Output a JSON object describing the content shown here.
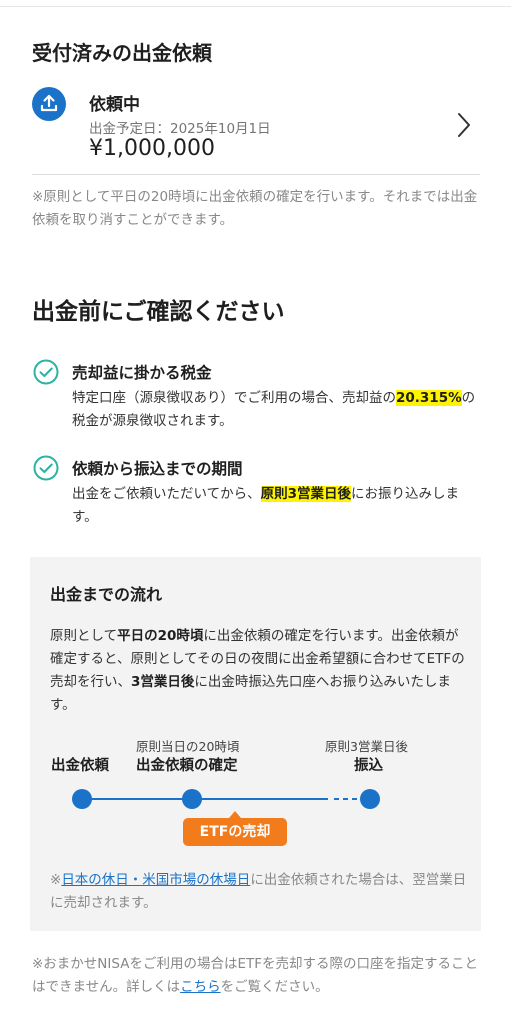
{
  "request_section": {
    "title": "受付済みの出金依頼",
    "status": "依頼中",
    "date_label": "出金予定日：",
    "date_value": "2025年10月1日",
    "amount": "¥1,000,000",
    "note": "※原則として平日の20時頃に出金依頼の確定を行います。それまでは出金依頼を取り消すことができます。"
  },
  "confirm": {
    "title": "出金前にご確認ください",
    "items": [
      {
        "title": "売却益に掛かる税金",
        "body_before": "特定口座（源泉徴収あり）でご利用の場合、売却益の",
        "body_highlight": "20.315%",
        "body_after": "の税金が源泉徴収されます。"
      },
      {
        "title": "依頼から振込までの期間",
        "body_before": "出金をご依頼いただいてから、",
        "body_highlight": "原則3営業日後",
        "body_after": "にお振り込みします。"
      }
    ]
  },
  "flow": {
    "title": "出金までの流れ",
    "desc_1": "原則として",
    "desc_2": "平日の20時頃",
    "desc_3": "に出金依頼の確定を行います。出金依頼が確定すると、原則としてその日の夜間に出金希望額に合わせてETFの売却を行い、",
    "desc_4": "3営業日後",
    "desc_5": "に出金時振込先口座へお振り込みいたします。",
    "steps": [
      {
        "sub": "",
        "main": "出金依頼"
      },
      {
        "sub": "原則当日の20時頃",
        "main": "出金依頼の確定"
      },
      {
        "sub": "原則3営業日後",
        "main": "振込"
      }
    ],
    "etf_label": "ETFの売却",
    "note_prefix": "※",
    "note_link": "日本の休日・米国市場の休場日",
    "note_suffix": "に出金依頼された場合は、翌営業日に売却されます。"
  },
  "footer_note": {
    "before": "※おまかせNISAをご利用の場合はETFを売却する際の口座を指定することはできません。詳しくは",
    "link": "こちら",
    "after": "をご覧ください。"
  },
  "colors": {
    "accent_blue": "#1a73c8",
    "check_teal": "#2bb3a3",
    "highlight": "#fff400",
    "etf_orange": "#f27b1c",
    "flow_bg": "#f3f3f3"
  },
  "icons": [
    "upload-icon",
    "chevron-right-icon",
    "check-circle-icon"
  ]
}
